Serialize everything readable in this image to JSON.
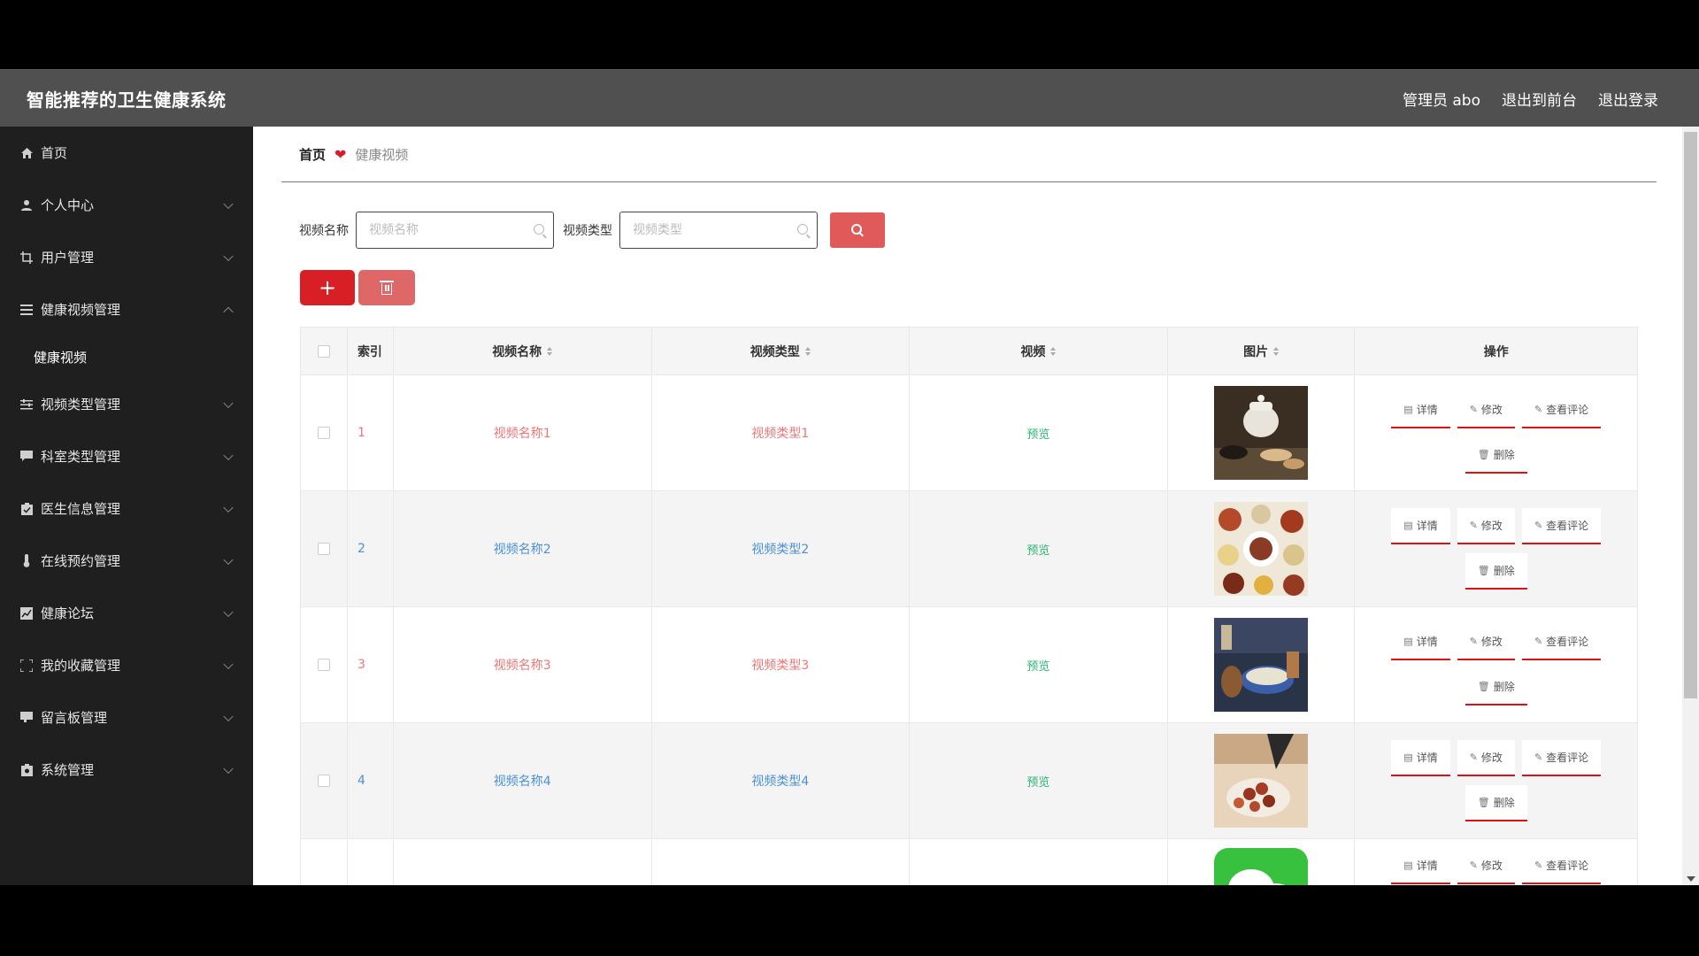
{
  "header": {
    "title": "智能推荐的卫生健康系统",
    "user": "管理员 abo",
    "to_front": "退出到前台",
    "logout": "退出登录"
  },
  "sidebar": {
    "items": [
      {
        "label": "首页",
        "icon": "home-icon"
      },
      {
        "label": "个人中心",
        "icon": "user-icon"
      },
      {
        "label": "用户管理",
        "icon": "crop-icon"
      },
      {
        "label": "健康视频管理",
        "icon": "list-icon",
        "expanded": true
      },
      {
        "label": "视频类型管理",
        "icon": "sliders-icon"
      },
      {
        "label": "科室类型管理",
        "icon": "comment-icon"
      },
      {
        "label": "医生信息管理",
        "icon": "clipboard-icon"
      },
      {
        "label": "在线预约管理",
        "icon": "thermometer-icon"
      },
      {
        "label": "健康论坛",
        "icon": "chart-icon"
      },
      {
        "label": "我的收藏管理",
        "icon": "frame-icon"
      },
      {
        "label": "留言板管理",
        "icon": "message-icon"
      },
      {
        "label": "系统管理",
        "icon": "settings-icon"
      }
    ],
    "sub_item": "健康视频"
  },
  "breadcrumb": {
    "home": "首页",
    "current": "健康视频"
  },
  "search": {
    "name_label": "视频名称",
    "name_placeholder": "视频名称",
    "type_label": "视频类型",
    "type_placeholder": "视频类型"
  },
  "table": {
    "headers": {
      "index": "索引",
      "name": "视频名称",
      "type": "视频类型",
      "video": "视频",
      "image": "图片",
      "ops": "操作"
    },
    "rows": [
      {
        "index": "1",
        "name": "视频名称1",
        "type": "视频类型1",
        "video": "预览"
      },
      {
        "index": "2",
        "name": "视频名称2",
        "type": "视频类型2",
        "video": "预览"
      },
      {
        "index": "3",
        "name": "视频名称3",
        "type": "视频类型3",
        "video": "预览"
      },
      {
        "index": "4",
        "name": "视频名称4",
        "type": "视频类型4",
        "video": "预览"
      }
    ],
    "ops": {
      "detail": "详情",
      "edit": "修改",
      "comments": "查看评论",
      "delete": "删除"
    }
  },
  "colors": {
    "header_bg": "#505050",
    "sidebar_bg": "#1f1f1f",
    "accent_red": "#d81f26",
    "preview_green": "#2bb873",
    "link_blue": "#4a90d9",
    "link_red": "#f07575"
  }
}
